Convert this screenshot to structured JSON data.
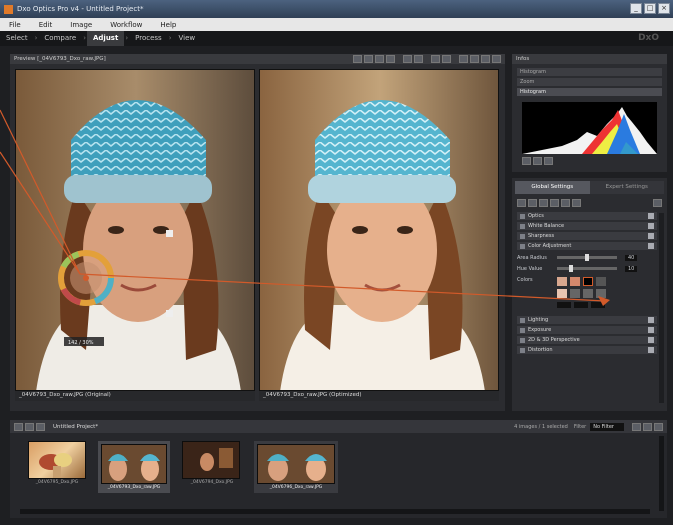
{
  "window": {
    "title": "Dxo Optics Pro v4 - Untitled Project*"
  },
  "menu": [
    "File",
    "Edit",
    "Image",
    "Workflow",
    "Help"
  ],
  "steps": [
    "Select",
    "Compare",
    "Adjust",
    "Process",
    "View"
  ],
  "active_step": "Adjust",
  "preview": {
    "header": "Preview [_04V6793_Dxo_raw.JPG]",
    "left_caption": "_04V6793_Dxo_raw.JPG (Original)",
    "right_caption": "_04V6793_Dxo_raw.JPG (Optimized)",
    "loupe_label": "142 / 30%"
  },
  "info": {
    "header": "Infos",
    "items": [
      "Histogram",
      "Zoom",
      "Histogram"
    ]
  },
  "settings": {
    "tabs": [
      "Global Settings",
      "Expert Settings"
    ],
    "sections": [
      "Optics",
      "White Balance",
      "Sharpness",
      "Color Adjustment"
    ],
    "rows": [
      {
        "label": "Area Radius",
        "value": "40"
      },
      {
        "label": "Hue Value",
        "value": "10"
      }
    ],
    "colors_label": "Colors",
    "sub_sections": [
      "Lighting",
      "Exposure",
      "2D & 3D Perspective",
      "Distortion"
    ]
  },
  "project": {
    "header": "Untitled Project*",
    "count": "4 images / 1 selected",
    "filter_label": "Filter",
    "filter_value": "No Filter",
    "thumbs": [
      {
        "label": "_04V6795_Dxo.JPG"
      },
      {
        "label": "_04V6793_Dxo_raw.JPG"
      },
      {
        "label": "_04V6794_Dxo.JPG"
      },
      {
        "label": "_04V6796_Dxo_raw.JPG"
      }
    ]
  },
  "colors": {
    "accent": "#d25a2a",
    "hat": "#4fb0c6",
    "panel": "#2b2c30"
  }
}
